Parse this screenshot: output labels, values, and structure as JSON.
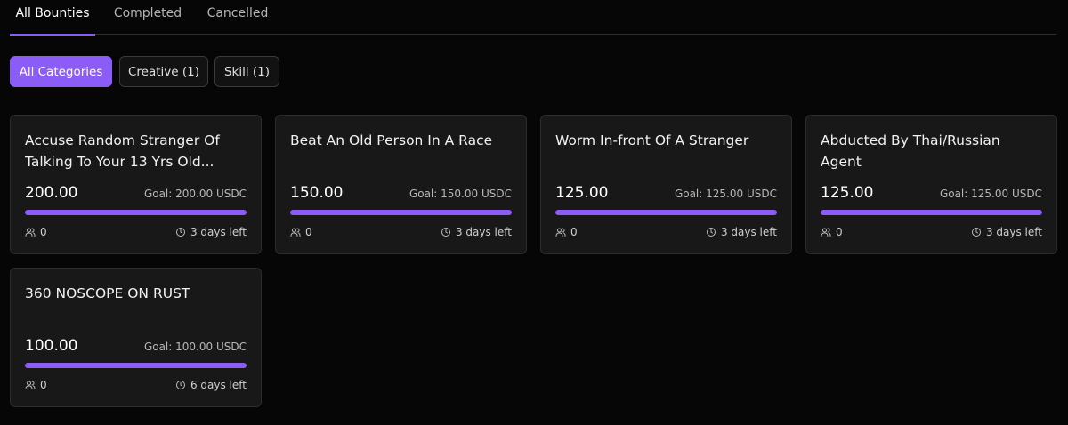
{
  "tabs": [
    {
      "label": "All Bounties",
      "active": true
    },
    {
      "label": "Completed",
      "active": false
    },
    {
      "label": "Cancelled",
      "active": false
    }
  ],
  "categories": [
    {
      "label": "All Categories",
      "active": true
    },
    {
      "label": "Creative (1)",
      "active": false
    },
    {
      "label": "Skill (1)",
      "active": false
    }
  ],
  "colors": {
    "accent": "#8b5cf6",
    "card_bg": "#181818",
    "page_bg": "#060606"
  },
  "goal_prefix": "Goal:",
  "currency": "USDC",
  "bounties": [
    {
      "title": "Accuse Random Stranger Of Talking To Your 13 Yrs Old...",
      "amount": "200.00",
      "goal": "200.00",
      "progress": 1.0,
      "participants": "0",
      "time_left": "3 days left",
      "participants_icon": "users-icon",
      "time_icon": "clock-icon"
    },
    {
      "title": "Beat An Old Person In A Race",
      "amount": "150.00",
      "goal": "150.00",
      "progress": 1.0,
      "participants": "0",
      "time_left": "3 days left",
      "participants_icon": "users-icon",
      "time_icon": "clock-icon"
    },
    {
      "title": "Worm In-front Of A Stranger",
      "amount": "125.00",
      "goal": "125.00",
      "progress": 1.0,
      "participants": "0",
      "time_left": "3 days left",
      "participants_icon": "users-icon",
      "time_icon": "clock-icon"
    },
    {
      "title": "Abducted By Thai/Russian Agent",
      "amount": "125.00",
      "goal": "125.00",
      "progress": 1.0,
      "participants": "0",
      "time_left": "3 days left",
      "participants_icon": "users-icon",
      "time_icon": "clock-icon"
    },
    {
      "title": "360 NOSCOPE ON RUST",
      "amount": "100.00",
      "goal": "100.00",
      "progress": 1.0,
      "participants": "0",
      "time_left": "6 days left",
      "participants_icon": "users-icon",
      "time_icon": "clock-icon"
    }
  ]
}
